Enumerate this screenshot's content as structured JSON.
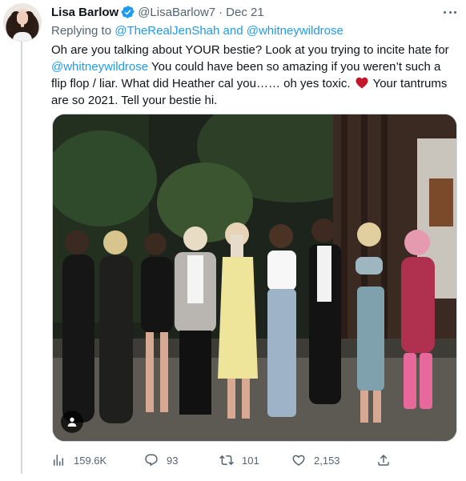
{
  "tweet": {
    "author_name": "Lisa Barlow",
    "author_handle": "@LisaBarlow7",
    "separator": "·",
    "date": "Dec 21",
    "replying_prefix": "Replying to",
    "replying_user1": "@TheRealJenShah",
    "replying_and": "and",
    "replying_user2": "@whitneywildrose",
    "text_part1": "Oh are you talking about YOUR bestie?  Look at you trying to incite hate for ",
    "text_mention": "@whitneywildrose",
    "text_part2": "  You could have been so amazing if you weren’t such a flip flop / liar. What did Heather cal you…… oh yes toxic. ",
    "text_part3": "  Your tantrums are so 2021. Tell your bestie hi.",
    "emoji": "red-heart"
  },
  "metrics": {
    "views": "159.6K",
    "replies": "93",
    "retweets": "101",
    "likes": "2,153"
  },
  "colors": {
    "link": "#1d9bf0",
    "secondary_text": "#536471",
    "verified_badge": "#1d9bf0",
    "heart": "#c4172c"
  },
  "icons": [
    "verified-badge-icon",
    "more-icon",
    "views-icon",
    "reply-icon",
    "retweet-icon",
    "like-icon",
    "share-icon",
    "user-tag-icon"
  ]
}
